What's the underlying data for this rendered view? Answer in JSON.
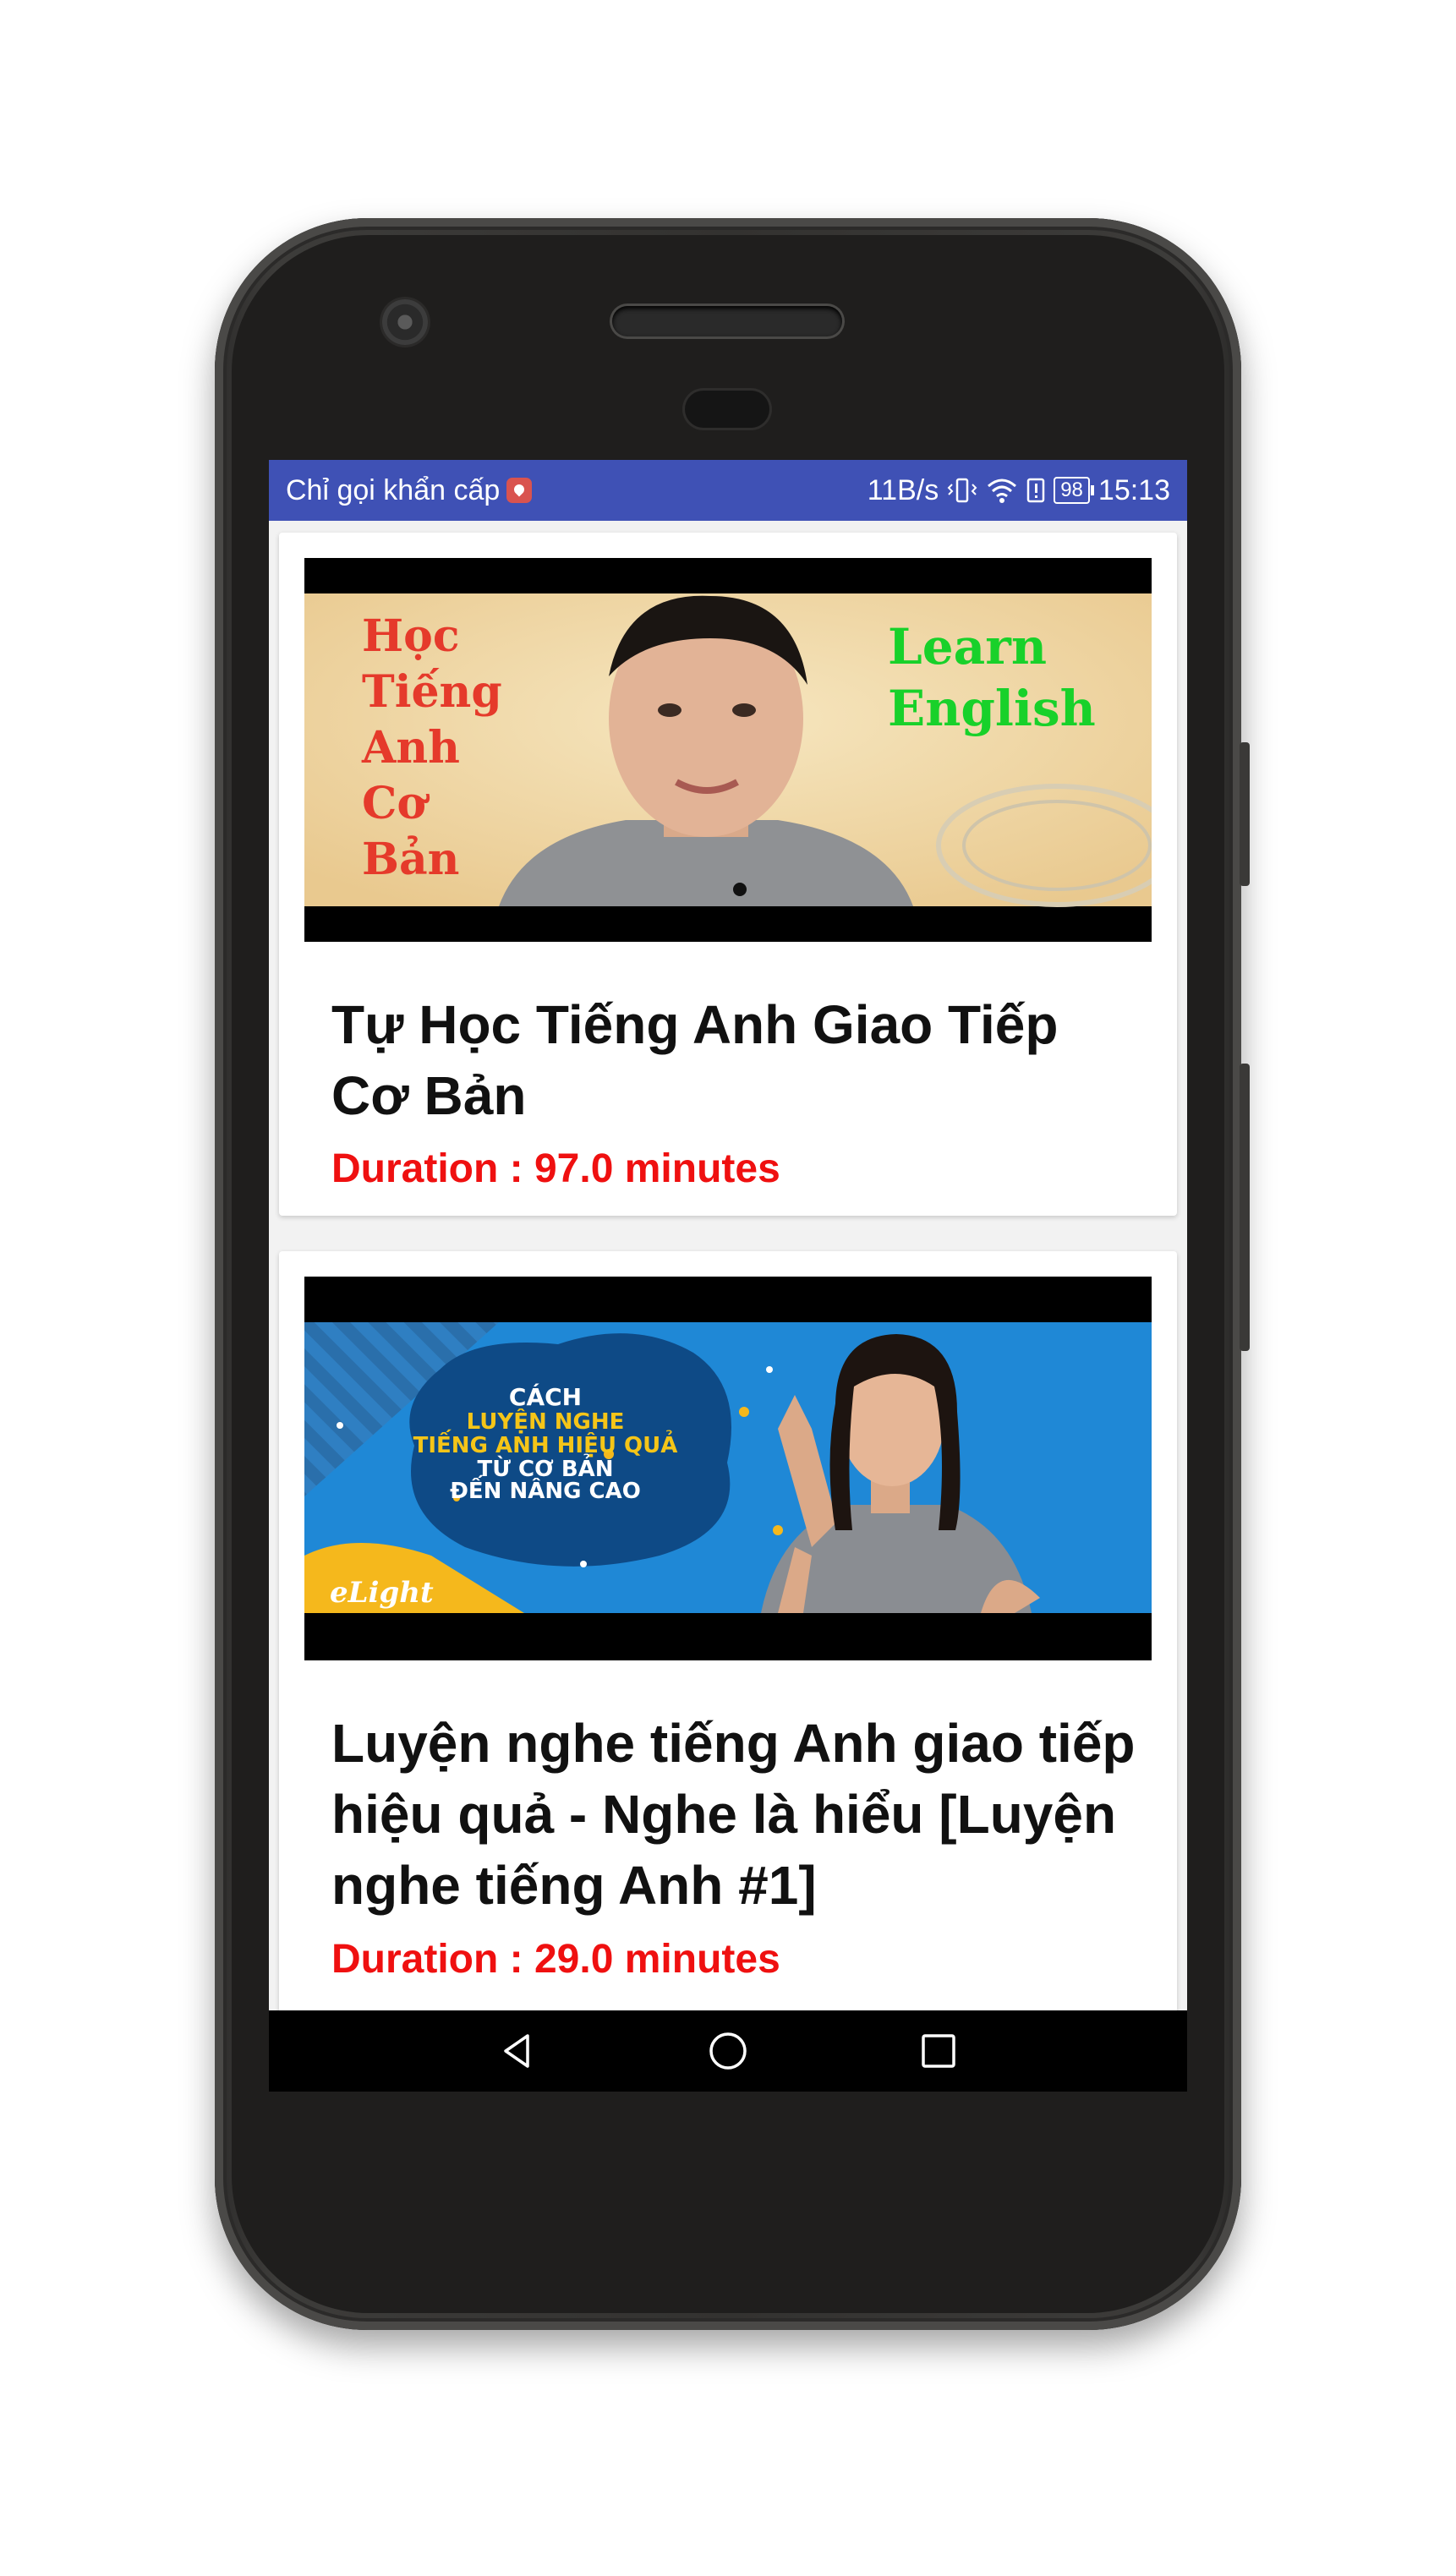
{
  "status_bar": {
    "carrier_text": "Chỉ gọi khẩn cấp",
    "network_speed": "11B/s",
    "battery_level": "98",
    "time": "15:13",
    "background_color": "#3f51b5",
    "icons": [
      "notification-badge-icon",
      "vibrate-icon",
      "wifi-icon",
      "alert-icon",
      "battery-icon"
    ]
  },
  "videos": [
    {
      "title": "Tự Học Tiếng Anh Giao Tiếp Cơ Bản",
      "duration": "Duration : 97.0 minutes",
      "thumbnail": {
        "left_text": [
          "Học",
          "Tiếng",
          "Anh",
          "Cơ",
          "Bản"
        ],
        "right_text": [
          "Learn",
          "English"
        ]
      }
    },
    {
      "title": "Luyện nghe tiếng Anh giao tiếp hiệu quả - Nghe là hiểu [Luyện nghe tiếng Anh #1]",
      "duration": "Duration : 29.0 minutes",
      "thumbnail": {
        "lines": [
          "CÁCH",
          "LUYỆN NGHE",
          "TIẾNG ANH HIỆU QUẢ",
          "TỪ CƠ BẢN",
          "ĐẾN NÂNG CAO"
        ],
        "logo": "eLight"
      }
    }
  ],
  "navigation": {
    "buttons": [
      "back-icon",
      "home-icon",
      "recents-icon"
    ]
  },
  "colors": {
    "duration_text": "#ef1010",
    "title_text": "#111111"
  }
}
